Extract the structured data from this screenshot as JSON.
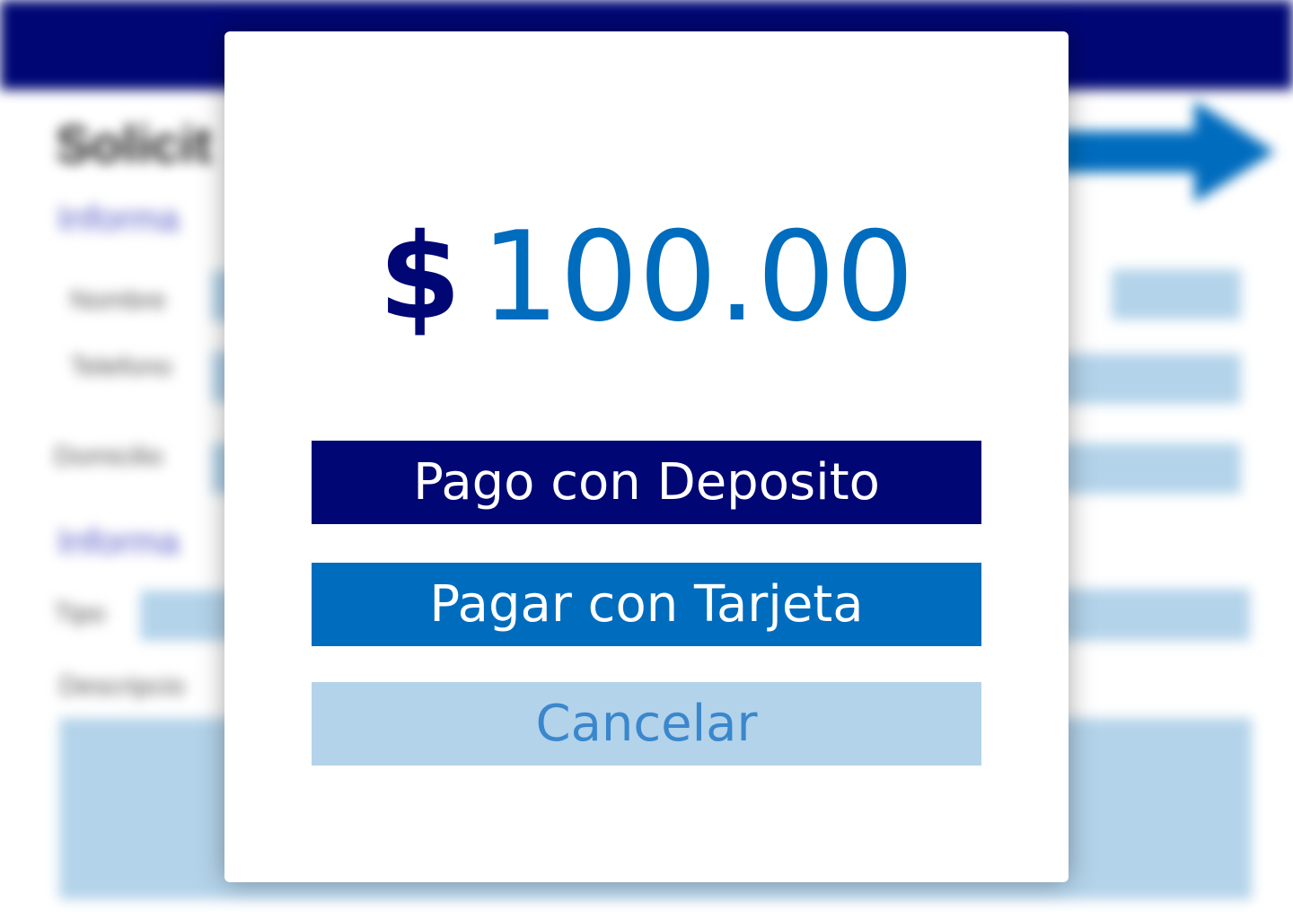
{
  "background": {
    "header_title": "",
    "page_title": "Solicit",
    "section_1": "Informa",
    "section_2": "Informa",
    "labels": {
      "nombre": "Nombre",
      "telefono": "Telefono",
      "domicilio": "Domicilio",
      "tipo": "Tipo",
      "descripcion": "Descripcio"
    },
    "arrow_text": ""
  },
  "modal": {
    "currency_symbol": "$",
    "amount": "100.00",
    "buttons": {
      "deposit": "Pago con Deposito",
      "card": "Pagar con Tarjeta",
      "cancel": "Cancelar"
    }
  },
  "colors": {
    "navy": "#000775",
    "blue": "#006cbe",
    "light_blue": "#b3d3ea",
    "cancel_text": "#3a87cd"
  }
}
